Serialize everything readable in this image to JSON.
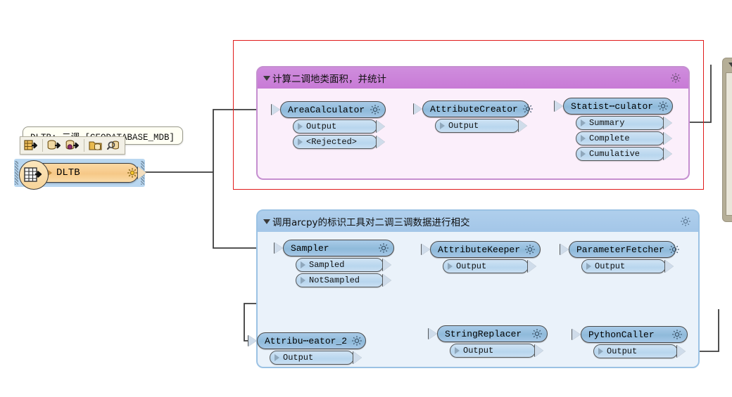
{
  "app": {
    "canvas_name": "fme-workbench-canvas",
    "background_color": "#ffffff"
  },
  "source_reader": {
    "label": "DLTB",
    "tooltip": "DLTB: 二调 [GEODATABASE_MDB]",
    "icon": "table-export-icon",
    "gear_icon": "gear-icon",
    "selected": true,
    "body_color": "#f6c887",
    "selection_color": "#b9d7f0"
  },
  "floating_toolbar": {
    "name": "reader-context-toolbar",
    "buttons": [
      {
        "name": "export-table-button",
        "icon": "table-export-icon"
      },
      {
        "name": "export-database-button",
        "icon": "database-export-icon"
      },
      {
        "name": "export-database-transform-button",
        "icon": "database-transform-export-icon"
      },
      {
        "name": "folder-database-button",
        "icon": "folder-database-icon"
      },
      {
        "name": "inspect-database-button",
        "icon": "database-search-icon"
      }
    ]
  },
  "annotation": {
    "name": "red-highlight-rectangle",
    "color": "#e01b1b"
  },
  "bookmarks": [
    {
      "id": "bookmark-area",
      "title": "计算二调地类面积，并统计",
      "theme": "pink",
      "header_color": "#c87ad6",
      "body_color": "#fbeffb",
      "collapse_icon": "triangle-down-icon",
      "gear_icon": "gear-icon"
    },
    {
      "id": "bookmark-arcpy",
      "title": "调用arcpy的标识工具对二调三调数据进行相交",
      "theme": "blue",
      "header_color": "#a3c6e8",
      "body_color": "#eaf2fa",
      "collapse_icon": "triangle-down-icon",
      "gear_icon": "gear-icon"
    }
  ],
  "transformers": [
    {
      "id": "area-calculator",
      "label": "AreaCalculator",
      "gear_icon": "gear-icon",
      "ports": [
        {
          "name": "output-port",
          "label": "Output"
        },
        {
          "name": "rejected-port",
          "label": "<Rejected>"
        }
      ]
    },
    {
      "id": "attribute-creator",
      "label": "AttributeCreator",
      "gear_icon": "gear-icon",
      "ports": [
        {
          "name": "output-port",
          "label": "Output"
        }
      ]
    },
    {
      "id": "statistics-calculator",
      "label": "Statist⋯culator",
      "gear_icon": "gear-icon",
      "ports": [
        {
          "name": "summary-port",
          "label": "Summary"
        },
        {
          "name": "complete-port",
          "label": "Complete"
        },
        {
          "name": "cumulative-port",
          "label": "Cumulative"
        }
      ]
    },
    {
      "id": "sampler",
      "label": "Sampler",
      "gear_icon": "gear-icon",
      "ports": [
        {
          "name": "sampled-port",
          "label": "Sampled"
        },
        {
          "name": "notsampled-port",
          "label": "NotSampled"
        }
      ]
    },
    {
      "id": "attribute-keeper",
      "label": "AttributeKeeper",
      "gear_icon": "gear-icon",
      "ports": [
        {
          "name": "output-port",
          "label": "Output"
        }
      ]
    },
    {
      "id": "parameter-fetcher",
      "label": "ParameterFetcher",
      "gear_icon": "gear-icon",
      "ports": [
        {
          "name": "output-port",
          "label": "Output"
        }
      ]
    },
    {
      "id": "attribute-creator-2",
      "label": "Attribu⋯eator_2",
      "gear_icon": "gear-icon",
      "ports": [
        {
          "name": "output-port",
          "label": "Output"
        }
      ]
    },
    {
      "id": "string-replacer",
      "label": "StringReplacer",
      "gear_icon": "gear-icon",
      "ports": [
        {
          "name": "output-port",
          "label": "Output"
        }
      ]
    },
    {
      "id": "python-caller",
      "label": "PythonCaller",
      "gear_icon": "gear-icon",
      "ports": [
        {
          "name": "output-port",
          "label": "Output"
        }
      ]
    }
  ],
  "dock_panel": {
    "name": "right-docked-panel",
    "collapse_icon": "triangle-down-icon",
    "background_color": "#b5ae97"
  },
  "theme": {
    "node_header": "#8fbada",
    "node_port": "#b8d6ee",
    "connector": "#3c3c3c",
    "pink_bookmark": "#c87ad6",
    "blue_bookmark": "#a3c6e8"
  }
}
